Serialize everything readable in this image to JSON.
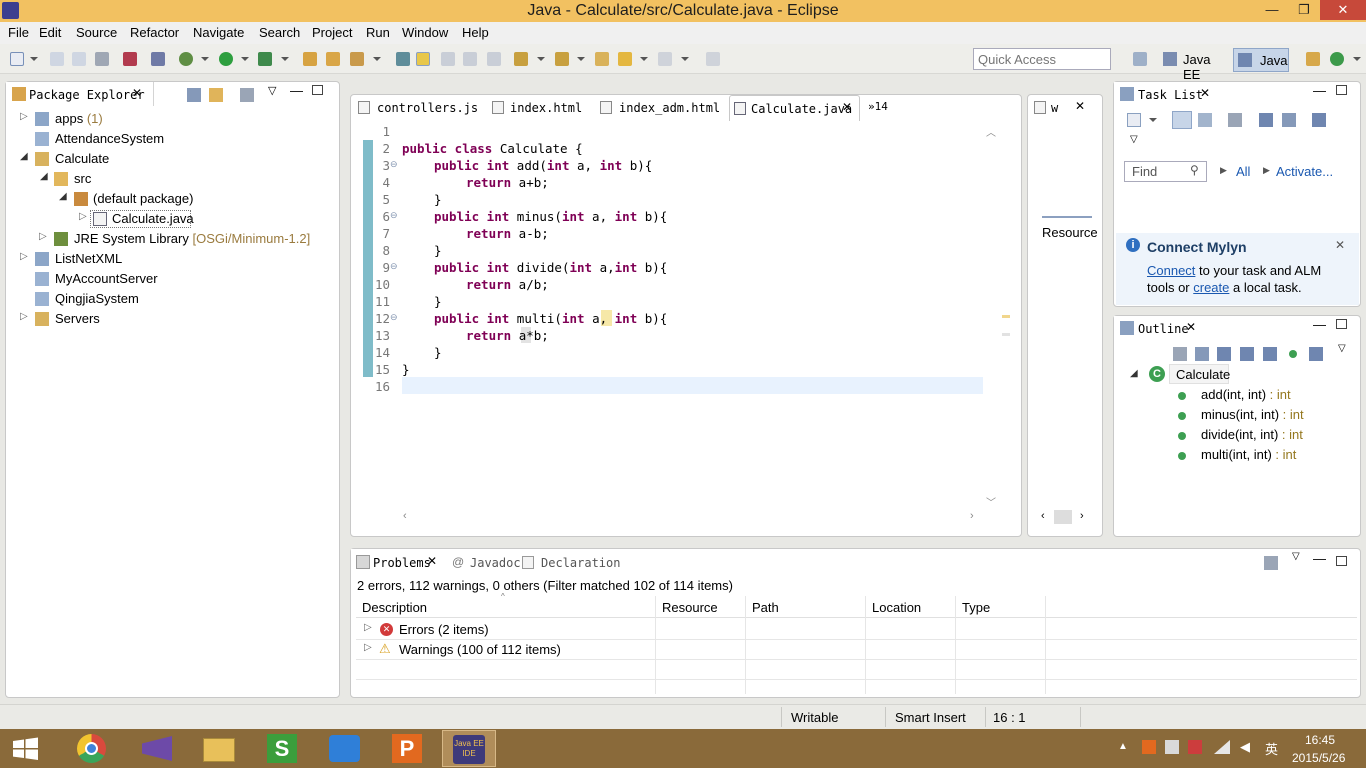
{
  "window": {
    "title": "Java - Calculate/src/Calculate.java - Eclipse",
    "min": "—",
    "max": "❐",
    "close": "✕"
  },
  "menu": [
    "File",
    "Edit",
    "Source",
    "Refactor",
    "Navigate",
    "Search",
    "Project",
    "Run",
    "Window",
    "Help"
  ],
  "quick_access": {
    "placeholder": "Quick Access"
  },
  "perspectives": {
    "javaee": "Java EE",
    "java": "Java"
  },
  "package_explorer": {
    "title": "Package Explorer",
    "items": {
      "apps": "apps",
      "apps_count": "(1)",
      "attendance": "AttendanceSystem",
      "calculate": "Calculate",
      "src": "src",
      "default_pkg": "(default package)",
      "calc_java": "Calculate.java",
      "jre": "JRE System Library",
      "jre_suffix": "[OSGi/Minimum-1.2]",
      "listnet": "ListNetXML",
      "myaccount": "MyAccountServer",
      "qingjia": "QingjiaSystem",
      "servers": "Servers"
    }
  },
  "editor": {
    "tabs": [
      "controllers.js",
      "index.html",
      "index_adm.html",
      "Calculate.java"
    ],
    "overflow": "»14",
    "line_numbers": [
      "1",
      "2",
      "3",
      "4",
      "5",
      "6",
      "7",
      "8",
      "9",
      "10",
      "11",
      "12",
      "13",
      "14",
      "15",
      "16"
    ],
    "code": {
      "l2a": "public class",
      "l2b": " Calculate {",
      "l3a": "public int",
      "l3b": " add(",
      "l3c": "int",
      "l3d": " a, ",
      "l3e": "int",
      "l3f": " b){",
      "l4a": "return",
      "l4b": " a+b;",
      "l5": "}",
      "l6a": "public int",
      "l6b": " minus(",
      "l6c": "int",
      "l6d": " a, ",
      "l6e": "int",
      "l6f": " b){",
      "l7a": "return",
      "l7b": " a-b;",
      "l8": "}",
      "l9a": "public int",
      "l9b": " divide(",
      "l9c": "int",
      "l9d": " a,",
      "l9e": "int",
      "l9f": " b){",
      "l10a": "return",
      "l10b": " a/b;",
      "l11": "}",
      "l12a": "public int",
      "l12b": " multi(",
      "l12c": "int",
      "l12d": " ",
      "l12e": "a",
      "l12f": ", ",
      "l12g": "int",
      "l12h": " b){",
      "l13a": "return",
      "l13b": " ",
      "l13c": "a",
      "l13d": "*b;",
      "l14": "}",
      "l15": "}"
    }
  },
  "side_view": {
    "tab": "w",
    "resource": "Resource"
  },
  "task_list": {
    "title": "Task List",
    "find_placeholder": "Find",
    "all": "All",
    "activate": "Activate..."
  },
  "mylyn": {
    "title": "Connect Mylyn",
    "connect": "Connect",
    "text1": " to your task and ALM",
    "text2": "tools or ",
    "create": "create",
    "text3": " a local task."
  },
  "outline": {
    "title": "Outline",
    "class": "Calculate",
    "methods": [
      {
        "name": "add(int, int)",
        "ret": " : int"
      },
      {
        "name": "minus(int, int)",
        "ret": " : int"
      },
      {
        "name": "divide(int, int)",
        "ret": " : int"
      },
      {
        "name": "multi(int, int)",
        "ret": " : int"
      }
    ]
  },
  "problems": {
    "tabs": {
      "problems": "Problems",
      "javadoc": "Javadoc",
      "declaration": "Declaration"
    },
    "summary": "2 errors, 112 warnings, 0 others (Filter matched 102 of 114 items)",
    "columns": [
      "Description",
      "Resource",
      "Path",
      "Location",
      "Type"
    ],
    "rows": [
      {
        "label": "Errors (2 items)"
      },
      {
        "label": "Warnings (100 of 112 items)"
      }
    ]
  },
  "status": {
    "writable": "Writable",
    "insert": "Smart Insert",
    "position": "16 : 1"
  },
  "taskbar": {
    "time": "16:45",
    "date": "2015/5/26",
    "ime": "英",
    "ide_label": "Java EE IDE"
  }
}
